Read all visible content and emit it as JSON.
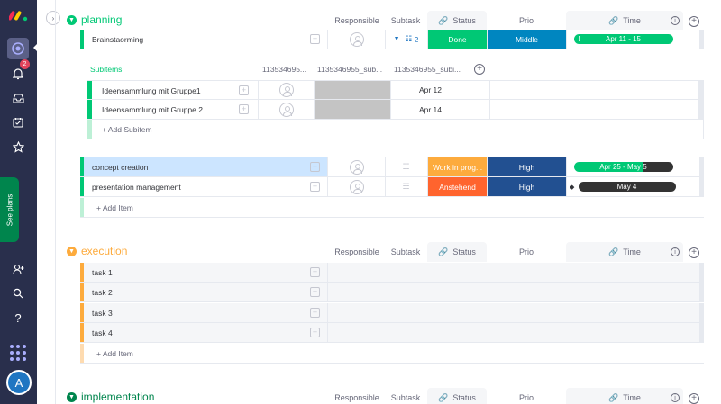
{
  "rail": {
    "notifications_count": "2",
    "see_plans": "See plans",
    "avatar_initial": "A"
  },
  "groups": [
    {
      "id": "planning",
      "title": "planning",
      "color": "#00c875",
      "columns": {
        "responsible": "Responsible",
        "subtask": "Subtask",
        "status": "Status",
        "prio": "Prio",
        "time": "Time"
      }
    },
    {
      "id": "execution",
      "title": "execution",
      "color": "#fdab3d",
      "columns": {
        "responsible": "Responsible",
        "subtask": "Subtask",
        "status": "Status",
        "prio": "Prio",
        "time": "Time"
      }
    },
    {
      "id": "implementation",
      "title": "implementation",
      "color": "#00854d",
      "columns": {
        "responsible": "Responsible",
        "subtask": "Subtask",
        "status": "Status",
        "prio": "Prio",
        "time": "Time"
      }
    }
  ],
  "planning_items": {
    "brainstorming": {
      "name": "Brainstaorming",
      "subtask_count": "2",
      "status": "Done",
      "status_color": "#00c875",
      "prio": "Middle",
      "prio_color": "#0086c0",
      "time": "Apr 11 - 15",
      "time_flag": "!"
    },
    "concept": {
      "name": "concept creation",
      "status": "Work in prog...",
      "status_color": "#fdab3d",
      "prio": "High",
      "prio_color": "#225091",
      "time": "Apr 25 - May 5"
    },
    "presentation": {
      "name": "presentation management",
      "status": "Anstehend",
      "status_color": "#ff642e",
      "prio": "High",
      "prio_color": "#225091",
      "time": "May 4"
    },
    "add_item": "+ Add Item"
  },
  "subitems": {
    "title": "Subitems",
    "col1": "113534695...",
    "col2": "1135346955_sub...",
    "col3": "1135346955_subi...",
    "rows": [
      {
        "name": "Ideensammlung mit Gruppe1",
        "date": "Apr 12"
      },
      {
        "name": "Ideensammlung mit Gruppe 2",
        "date": "Apr 14"
      }
    ],
    "add_subitem": "+ Add Subitem"
  },
  "execution_items": {
    "rows": [
      {
        "name": "task 1"
      },
      {
        "name": "task 2"
      },
      {
        "name": "task 3"
      },
      {
        "name": "task 4"
      }
    ],
    "add_item": "+ Add Item"
  }
}
